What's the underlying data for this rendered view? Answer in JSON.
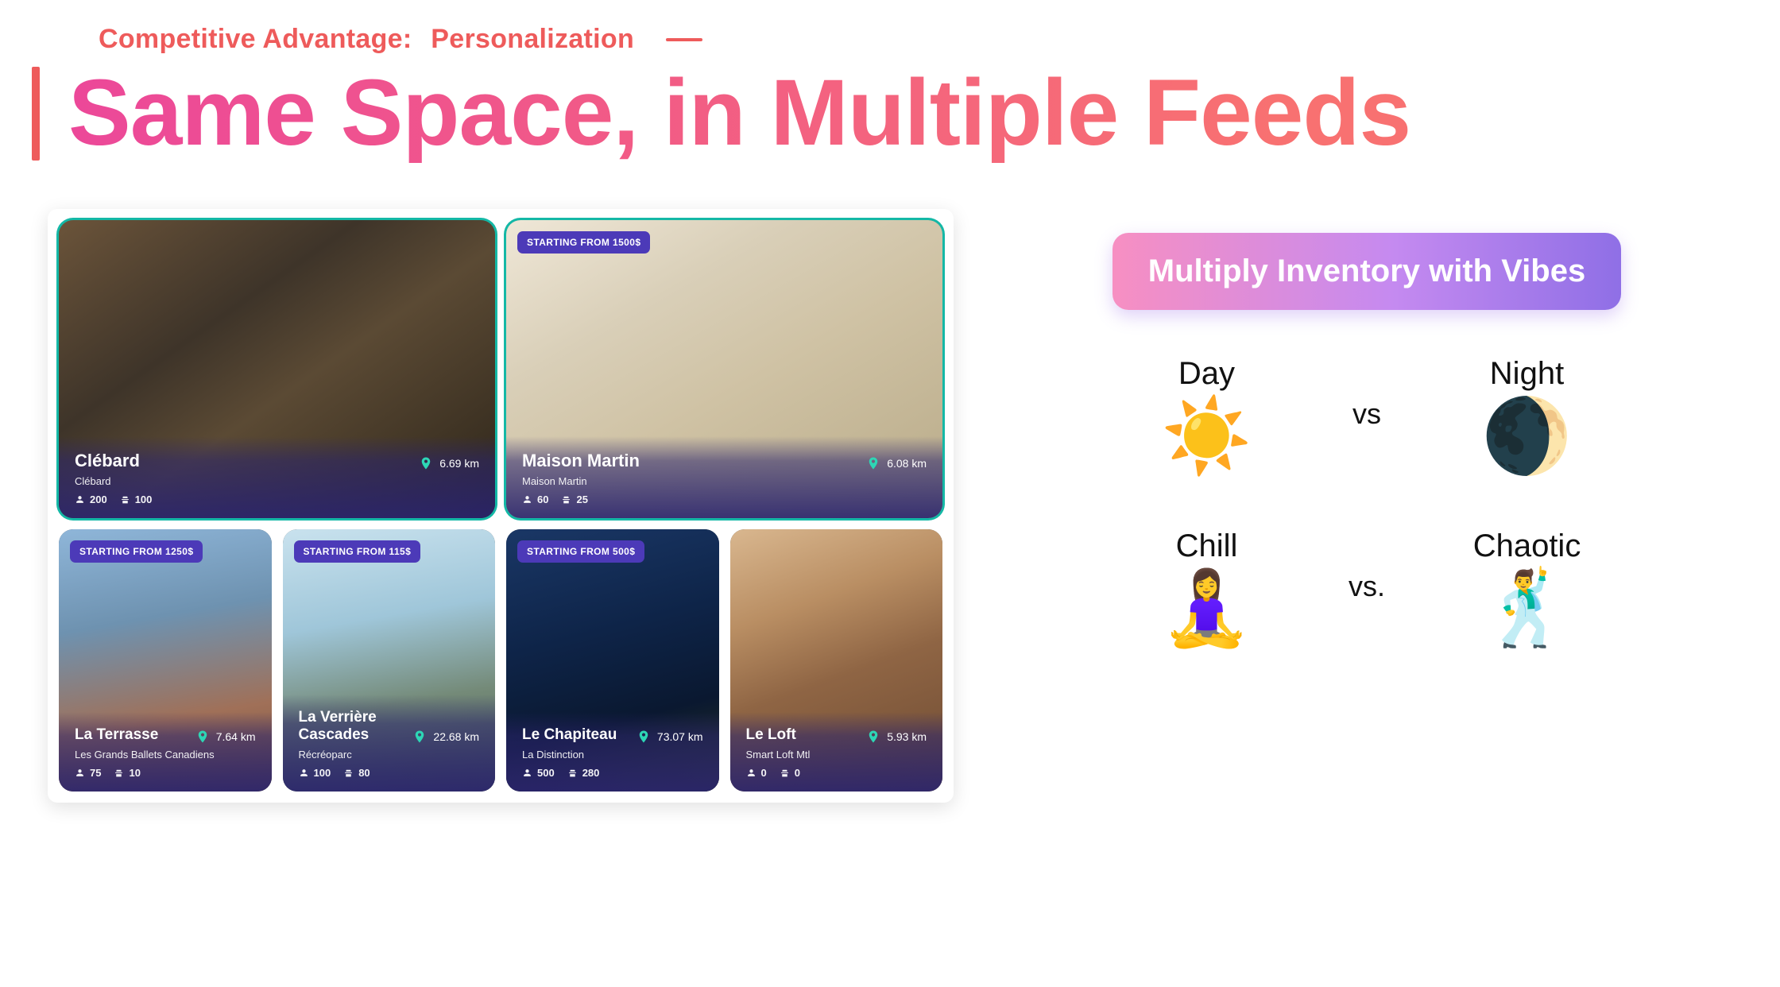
{
  "header": {
    "eyebrow_label": "Competitive Advantage:",
    "eyebrow_sub": "Personalization",
    "title": "Same Space, in Multiple Feeds"
  },
  "gallery": {
    "featured": [
      {
        "name": "Clébard",
        "host": "Clébard",
        "distance": "6.69 km",
        "capacity": 200,
        "seated": 100,
        "price_badge": null,
        "photo_class": "photo-bar"
      },
      {
        "name": "Maison Martin",
        "host": "Maison Martin",
        "distance": "6.08 km",
        "capacity": 60,
        "seated": 25,
        "price_badge": "STARTING FROM 1500$",
        "photo_class": "photo-hall"
      }
    ],
    "row": [
      {
        "name": "La Terrasse",
        "host": "Les Grands Ballets Canadiens",
        "distance": "7.64 km",
        "capacity": 75,
        "seated": 10,
        "price_badge": "STARTING FROM 1250$",
        "photo_class": "photo-terrace"
      },
      {
        "name": "La Verrière Cascades",
        "host": "Récréoparc",
        "distance": "22.68 km",
        "capacity": 100,
        "seated": 80,
        "price_badge": "STARTING FROM 115$",
        "photo_class": "photo-glass"
      },
      {
        "name": "Le Chapiteau",
        "host": "La Distinction",
        "distance": "73.07 km",
        "capacity": 500,
        "seated": 280,
        "price_badge": "STARTING FROM 500$",
        "photo_class": "photo-tent"
      },
      {
        "name": "Le Loft",
        "host": "Smart Loft Mtl",
        "distance": "5.93 km",
        "capacity": 0,
        "seated": 0,
        "price_badge": null,
        "photo_class": "photo-loft"
      }
    ]
  },
  "right": {
    "pill": "Multiply Inventory with Vibes",
    "pairs": [
      {
        "left_label": "Day",
        "left_emoji": "☀️",
        "vs": "vs",
        "right_label": "Night",
        "right_emoji": "🌒"
      },
      {
        "left_label": "Chill",
        "left_emoji": "🧘‍♀️",
        "vs": "vs.",
        "right_label": "Chaotic",
        "right_emoji": "🕺"
      }
    ]
  }
}
